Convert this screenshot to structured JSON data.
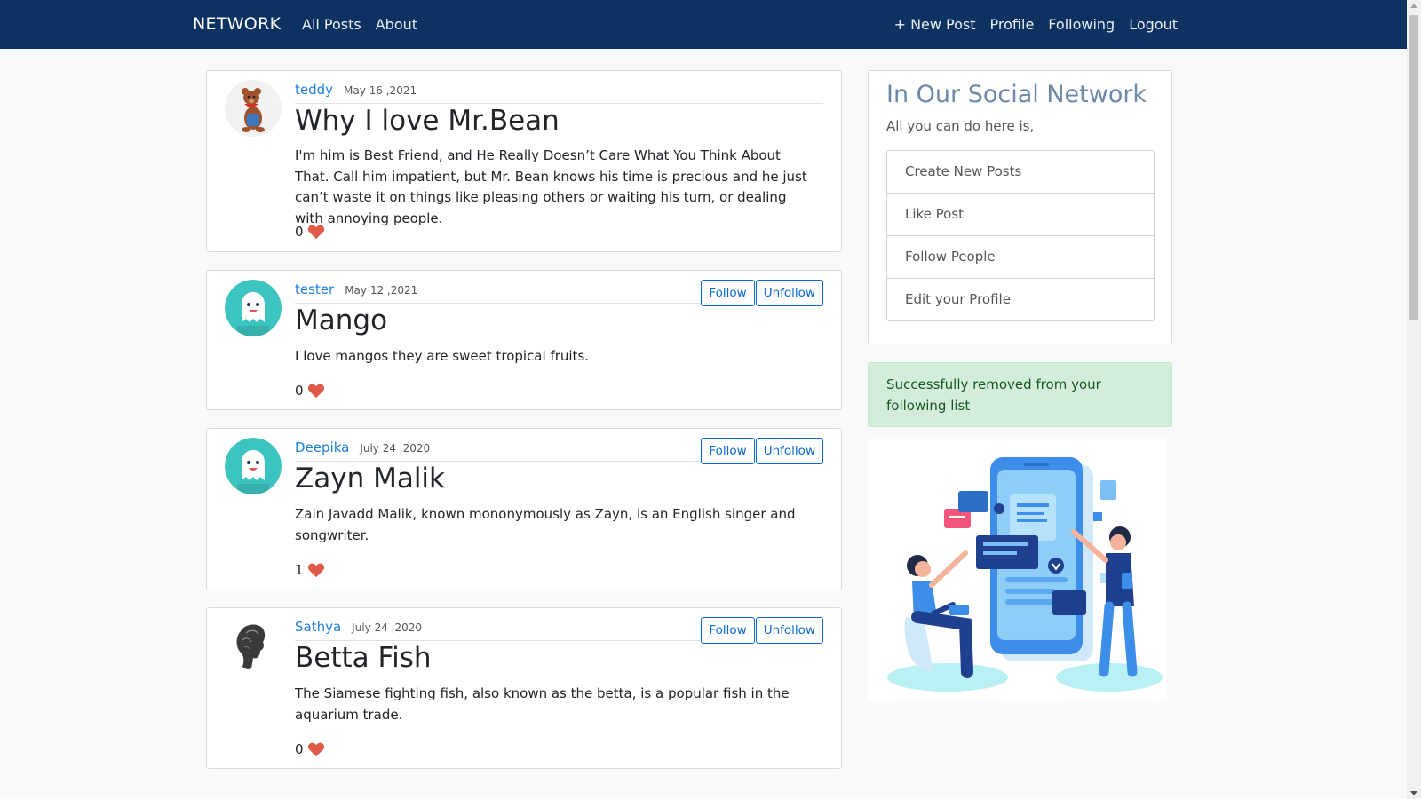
{
  "nav": {
    "brand": "NETWORK",
    "left": [
      "All Posts",
      "About"
    ],
    "right": [
      "+ New Post",
      "Profile",
      "Following",
      "Logout"
    ]
  },
  "posts": [
    {
      "author": "teddy",
      "date": "May 16 ,2021",
      "title": "Why I love Mr.Bean",
      "body": "I'm him is Best Friend, and He Really Doesn’t Care What You Think About That. Call him impatient, but Mr. Bean knows his time is precious and he just can’t waste it on things like pleasing others or waiting his turn, or dealing with annoying people.",
      "likes": "0",
      "avatar_icon": "teddy-bear-avatar-icon"
    },
    {
      "author": "tester",
      "date": "May 12 ,2021",
      "title": "Mango",
      "body": "I love mangos they are sweet tropical fruits.",
      "likes": "0",
      "follow_label": "Follow",
      "unfollow_label": "Unfollow",
      "avatar_icon": "ghost-avatar-icon"
    },
    {
      "author": "Deepika",
      "date": "July 24 ,2020",
      "title": "Zayn Malik",
      "body": "Zain Javadd Malik, known mononymously as Zayn, is an English singer and songwriter.",
      "likes": "1",
      "follow_label": "Follow",
      "unfollow_label": "Unfollow",
      "avatar_icon": "ghost-avatar-icon"
    },
    {
      "author": "Sathya",
      "date": "July 24 ,2020",
      "title": "Betta Fish",
      "body": "The Siamese fighting fish, also known as the betta, is a popular fish in the aquarium trade.",
      "likes": "0",
      "follow_label": "Follow",
      "unfollow_label": "Unfollow",
      "avatar_icon": "sketch-portrait-avatar-icon"
    }
  ],
  "sidebar": {
    "title": "In Our Social Network",
    "subtitle": "All you can do here is,",
    "items": [
      "Create New Posts",
      "Like Post",
      "Follow People",
      "Edit your Profile"
    ],
    "alert": "Successfully removed from your following list"
  },
  "colors": {
    "navbar": "#0d3261",
    "link": "#1d7fd8",
    "heart": "#e05a4a",
    "alert_bg": "#d4edda",
    "avatar_teal": "#3cc4c0"
  }
}
